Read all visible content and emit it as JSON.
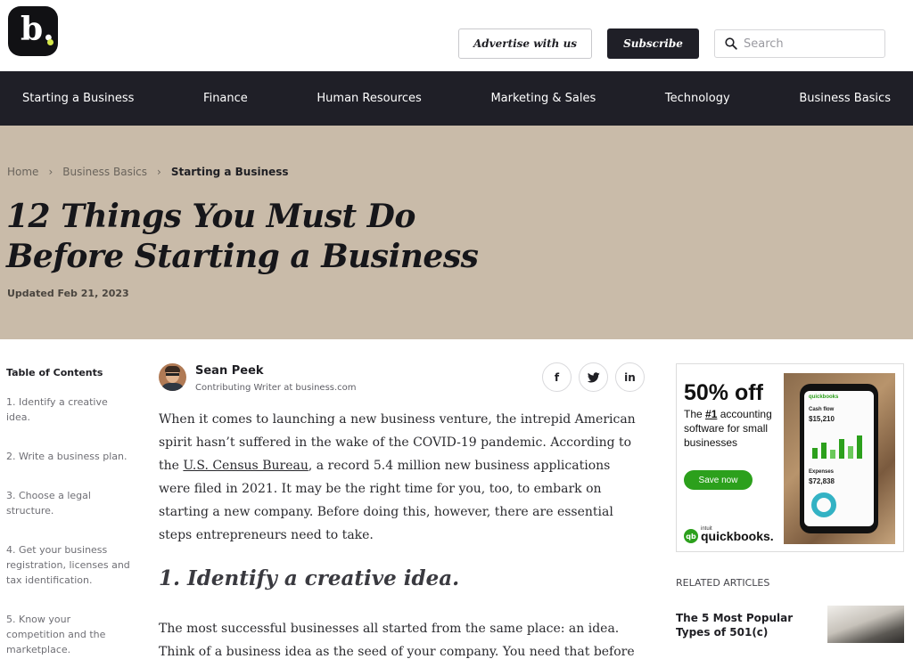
{
  "header": {
    "logo_letter": "b.",
    "advertise_label": "Advertise with us",
    "subscribe_label": "Subscribe",
    "search_placeholder": "Search",
    "accent_color": "#d6e84a"
  },
  "nav": {
    "items": [
      "Starting a Business",
      "Finance",
      "Human Resources",
      "Marketing & Sales",
      "Technology",
      "Business Basics"
    ]
  },
  "hero": {
    "breadcrumb": [
      "Home",
      "Business Basics",
      "Starting a Business"
    ],
    "title_line1": "12 Things You Must Do",
    "title_line2": "Before Starting a Business",
    "updated": "Updated Feb 21, 2023",
    "background_color": "#c9bba9"
  },
  "toc": {
    "title": "Table of Contents",
    "items": [
      "1. Identify a creative idea.",
      "2. Write a business plan.",
      "3. Choose a legal structure.",
      "4. Get your business registration, licenses and tax identification.",
      "5. Know your competition and the marketplace."
    ]
  },
  "article": {
    "author_name": "Sean Peek",
    "author_role": "Contributing Writer at business.com",
    "share_icons": [
      "facebook-icon",
      "twitter-icon",
      "linkedin-icon"
    ],
    "intro_before_link": "When it comes to launching a new business venture, the intrepid American spirit hasn’t suffered in the wake of the COVID-19 pandemic. According to the ",
    "intro_link": "U.S. Census Bureau",
    "intro_after_link": ", a record 5.4 million new business applications were filed in 2021. It may be the right time for you, too, to embark on starting a new company. Before doing this, however, there are essential steps entrepreneurs need to take.",
    "section1_heading": "1. Identify a creative idea.",
    "section1_text": "The most successful businesses all started from the same place: an idea. Think of a business idea as the seed of your company. You need that before"
  },
  "ad": {
    "headline": "50% off",
    "sub_prefix": "The ",
    "sub_highlight": "#1",
    "sub_suffix": " accounting software for small businesses",
    "cta": "Save now",
    "brand_small": "intuit",
    "brand": "quickbooks.",
    "brand_color": "#2ca01c",
    "phone_app": "quickbooks",
    "phone_cashflow_label": "Cash flow",
    "phone_cashflow_value": "$15,210",
    "phone_expenses_label": "Expenses",
    "phone_expenses_value": "$72,838"
  },
  "related": {
    "title": "RELATED ARTICLES",
    "items": [
      {
        "title": "The 5 Most Popular Types of 501(c)"
      }
    ]
  }
}
